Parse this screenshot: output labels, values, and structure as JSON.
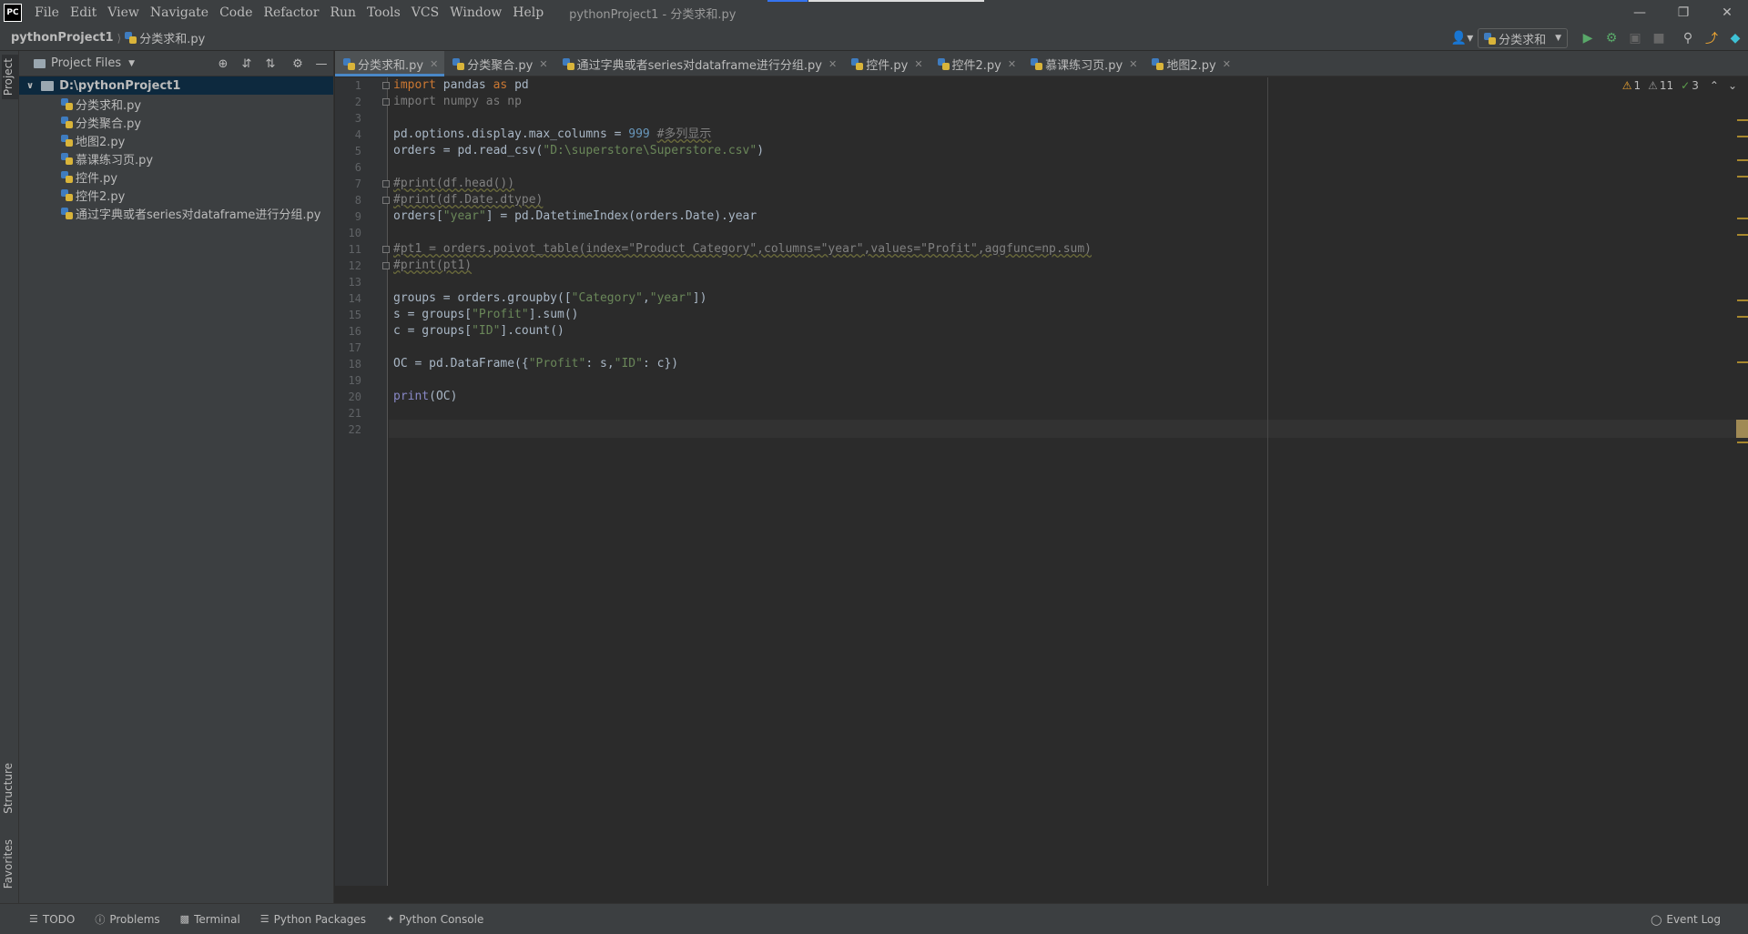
{
  "titlebar": {
    "logo": "PC",
    "menu": [
      "File",
      "Edit",
      "View",
      "Navigate",
      "Code",
      "Refactor",
      "Run",
      "Tools",
      "VCS",
      "Window",
      "Help"
    ],
    "window_title": "pythonProject1 - 分类求和.py"
  },
  "navbar": {
    "project": "pythonProject1",
    "file": "分类求和.py",
    "run_config": "分类求和"
  },
  "left_strip": {
    "project": "Project",
    "structure": "Structure",
    "favorites": "Favorites"
  },
  "project_panel": {
    "title": "Project Files",
    "root": "D:\\pythonProject1",
    "files": [
      "分类求和.py",
      "分类聚合.py",
      "地图2.py",
      "慕课练习页.py",
      "控件.py",
      "控件2.py",
      "通过字典或者series对dataframe进行分组.py"
    ]
  },
  "tabs": [
    {
      "label": "分类求和.py",
      "active": true
    },
    {
      "label": "分类聚合.py",
      "active": false
    },
    {
      "label": "通过字典或者series对dataframe进行分组.py",
      "active": false
    },
    {
      "label": "控件.py",
      "active": false
    },
    {
      "label": "控件2.py",
      "active": false
    },
    {
      "label": "慕课练习页.py",
      "active": false
    },
    {
      "label": "地图2.py",
      "active": false
    }
  ],
  "inspections": {
    "warnings": "1",
    "weak_warnings": "11",
    "ok": "3"
  },
  "code_lines": [
    "import pandas as pd",
    "import numpy as np",
    "",
    "pd.options.display.max_columns = 999 #多列显示",
    "orders = pd.read_csv(\"D:\\superstore\\Superstore.csv\")",
    "",
    "#print(df.head())",
    "#print(df.Date.dtype)",
    "orders[\"year\"] = pd.DatetimeIndex(orders.Date).year",
    "",
    "#pt1 = orders.poivot_table(index=\"Product Category\",columns=\"year\",values=\"Profit\",aggfunc=np.sum)",
    "#print(pt1)",
    "",
    "groups = orders.groupby([\"Category\",\"year\"])",
    "s = groups[\"Profit\"].sum()",
    "c = groups[\"ID\"].count()",
    "",
    "OC = pd.DataFrame({\"Profit\": s,\"ID\": c})",
    "",
    "print(OC)",
    "",
    ""
  ],
  "bottom": {
    "todo": "TODO",
    "problems": "Problems",
    "terminal": "Terminal",
    "python_packages": "Python Packages",
    "python_console": "Python Console",
    "event_log": "Event Log"
  }
}
